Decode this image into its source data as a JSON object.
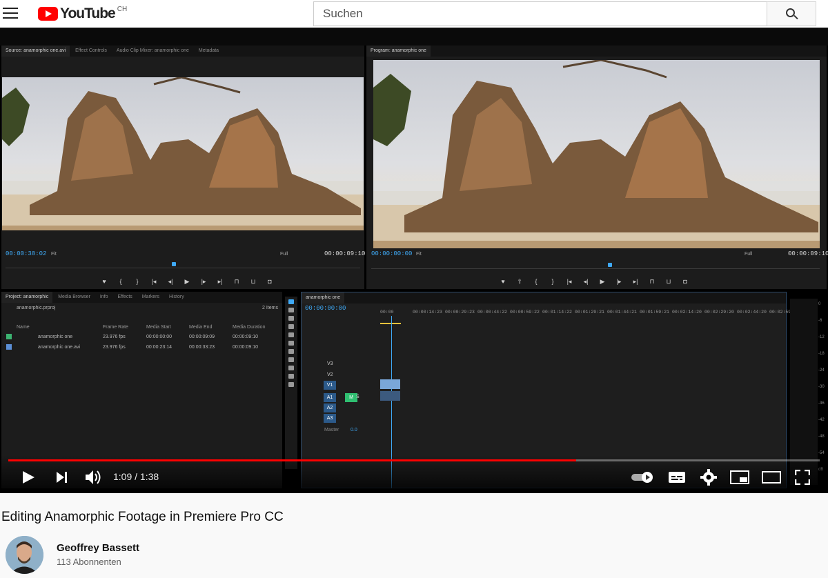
{
  "header": {
    "logo_text": "YouTube",
    "country_code": "CH",
    "search_placeholder": "Suchen",
    "brand_color": "#ff0000"
  },
  "player": {
    "current_time": "1:09",
    "duration": "1:38",
    "time_display": "1:09 / 1:38",
    "progress_fraction": 0.7,
    "progress_color": "#ff0000"
  },
  "premiere": {
    "source_panel": {
      "tabs": [
        "Source: anamorphic one.avi",
        "Effect Controls",
        "Audio Clip Mixer: anamorphic one",
        "Metadata"
      ],
      "timecode_in": "00:00:38:02",
      "fit": "Fit",
      "quality": "Full",
      "timecode_out": "00:00:09:10"
    },
    "program_panel": {
      "tabs": [
        "Program: anamorphic one"
      ],
      "timecode_in": "00:00:00:00",
      "fit": "Fit",
      "quality": "Full",
      "timecode_out": "00:00:09:10"
    },
    "project_panel": {
      "tabs": [
        "Project: anamorphic",
        "Media Browser",
        "Info",
        "Effects",
        "Markers",
        "History"
      ],
      "file": "anamorphic.prproj",
      "item_count": "2 Items",
      "columns": [
        "Name",
        "Frame Rate",
        "Media Start",
        "Media End",
        "Media Duration"
      ],
      "rows": [
        {
          "name": "anamorphic one",
          "frame_rate": "23.976 fps",
          "start": "00:00:00:00",
          "end": "00:00:09:09",
          "duration": "00:00:09:10",
          "color": "#3cb371"
        },
        {
          "name": "anamorphic one.avi",
          "frame_rate": "23.976 fps",
          "start": "00:00:23:14",
          "end": "00:00:33:23",
          "duration": "00:00:09:10",
          "color": "#5b8fd6"
        }
      ]
    },
    "timeline": {
      "tab": "anamorphic one",
      "timecode": "00:00:00:00",
      "ruler": [
        "00:00",
        "00:00:14:23",
        "00:00:29:23",
        "00:00:44:22",
        "00:00:59:22",
        "00:01:14:22",
        "00:01:29:21",
        "00:01:44:21",
        "00:01:59:21",
        "00:02:14:20",
        "00:02:29:20",
        "00:02:44:20",
        "00:02:59:1"
      ],
      "tracks": {
        "video": [
          "V3",
          "V2",
          "V1"
        ],
        "audio": [
          "A1",
          "A2",
          "A3"
        ],
        "master": "Master",
        "master_value": "0.0",
        "mute_label": "M",
        "solo_label": "S"
      },
      "meter_ticks": [
        "0",
        "-6",
        "-12",
        "-18",
        "-24",
        "-30",
        "-36",
        "-42",
        "-48",
        "-54",
        "dB"
      ]
    }
  },
  "video": {
    "title": "Editing Anamorphic Footage in Premiere Pro CC",
    "channel": "Geoffrey Bassett",
    "subscribers": "113 Abonnenten"
  },
  "icons": {
    "menu": "hamburger-menu-icon",
    "search": "search-icon",
    "play": "play-icon",
    "next": "next-icon",
    "volume": "volume-icon",
    "autoplay": "autoplay-toggle-icon",
    "subtitles": "subtitles-icon",
    "settings": "gear-icon",
    "miniplayer": "miniplayer-icon",
    "theater": "theater-mode-icon",
    "fullscreen": "fullscreen-icon"
  }
}
